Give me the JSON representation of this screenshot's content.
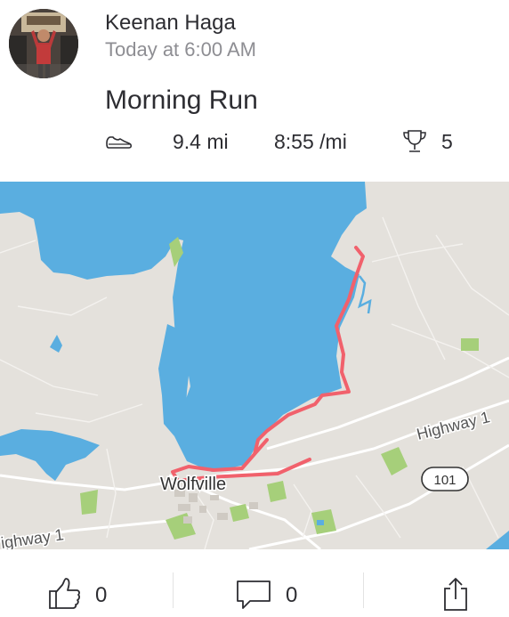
{
  "activity": {
    "athlete_name": "Keenan Haga",
    "timestamp": "Today at 6:00 AM",
    "title": "Morning Run",
    "sport_icon": "shoe-icon",
    "distance": "9.4 mi",
    "pace": "8:55 /mi",
    "achievements_icon": "trophy-icon",
    "achievements": "5"
  },
  "map": {
    "labels": {
      "town": "Wolfville",
      "highway_1_east": "Highway 1",
      "highway_1_west": "ighway 1",
      "route_shield": "101"
    },
    "colors": {
      "water": "#5aaee0",
      "land": "#e4e1dc",
      "route": "#f1616c",
      "park": "#a6cf7a"
    }
  },
  "actions": {
    "kudos_icon": "thumbs-up-icon",
    "kudos_count": "0",
    "comment_icon": "comment-icon",
    "comment_count": "0",
    "share_icon": "share-icon"
  }
}
